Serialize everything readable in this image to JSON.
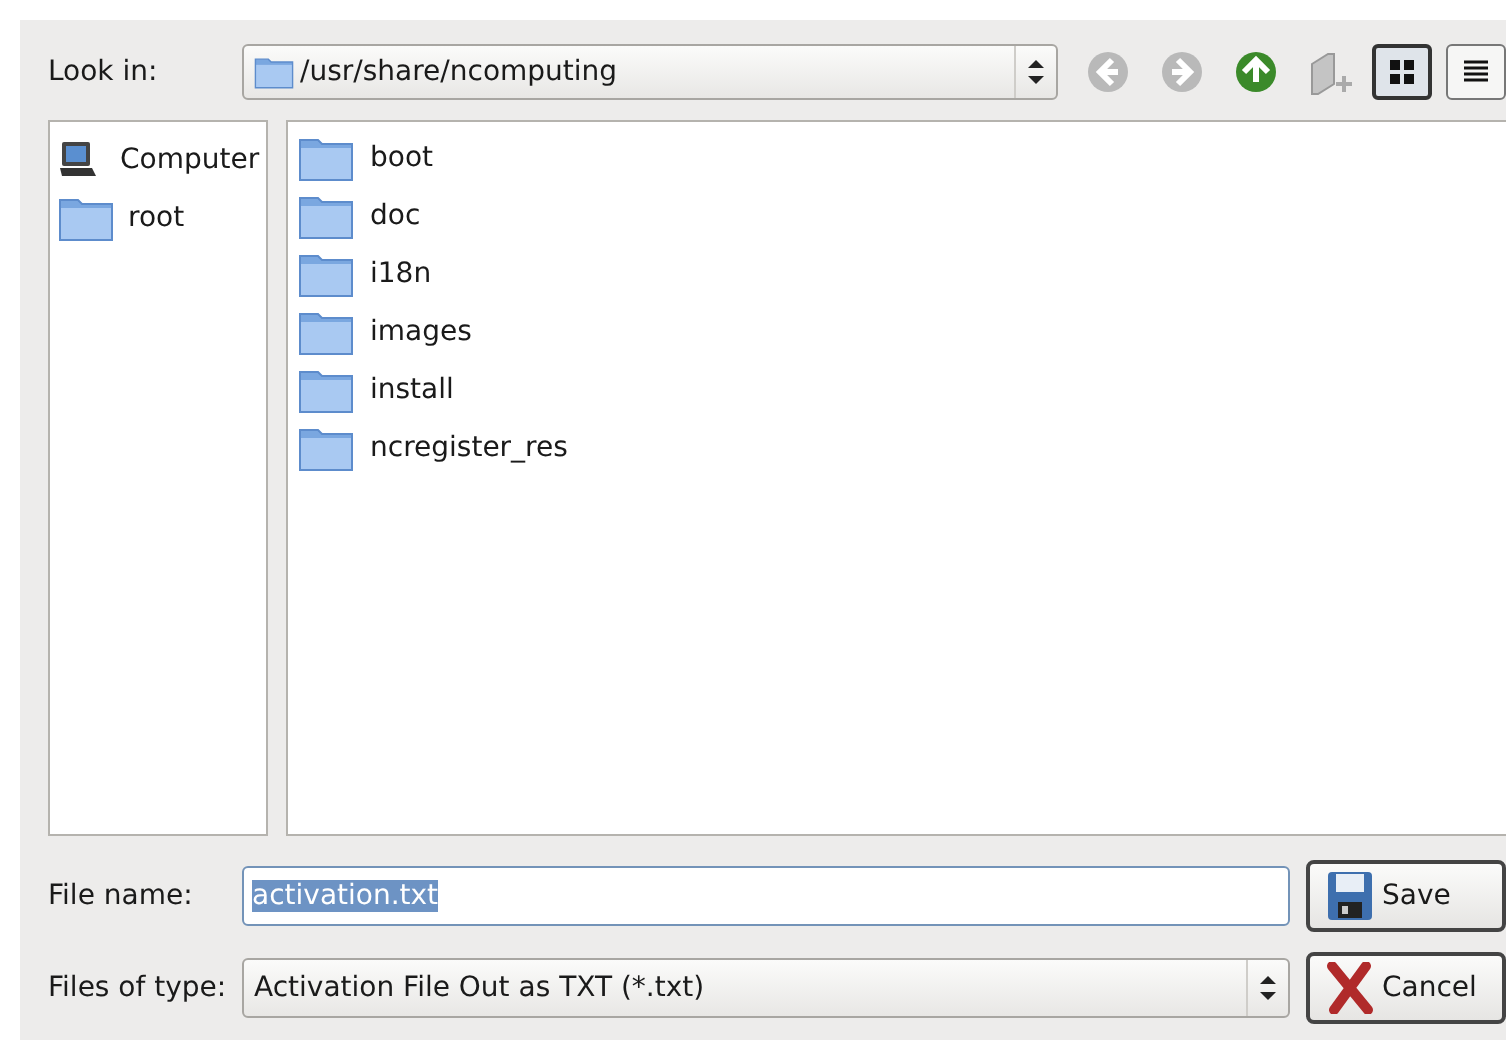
{
  "look_in": {
    "label": "Look in:",
    "path": "/usr/share/ncomputing"
  },
  "toolbar": [
    {
      "kind": "back",
      "disabled": true
    },
    {
      "kind": "forward",
      "disabled": true
    },
    {
      "kind": "up",
      "disabled": false
    },
    {
      "kind": "new-folder",
      "disabled": true
    }
  ],
  "views": [
    {
      "kind": "list",
      "selected": true
    },
    {
      "kind": "detail",
      "selected": false
    }
  ],
  "sidebar": {
    "items": [
      {
        "kind": "computer",
        "label": "Computer"
      },
      {
        "kind": "folder",
        "label": "root"
      }
    ]
  },
  "files": [
    {
      "label": "boot"
    },
    {
      "label": "doc"
    },
    {
      "label": "i18n"
    },
    {
      "label": "images"
    },
    {
      "label": "install"
    },
    {
      "label": "ncregister_res"
    }
  ],
  "file_name": {
    "label": "File name:",
    "value": "activation.txt",
    "text_selected": true
  },
  "file_type": {
    "label": "Files of type:",
    "value": "Activation File Out as TXT (*.txt)"
  },
  "buttons": [
    {
      "kind": "save",
      "label": "Save"
    },
    {
      "kind": "cancel",
      "label": "Cancel"
    }
  ]
}
